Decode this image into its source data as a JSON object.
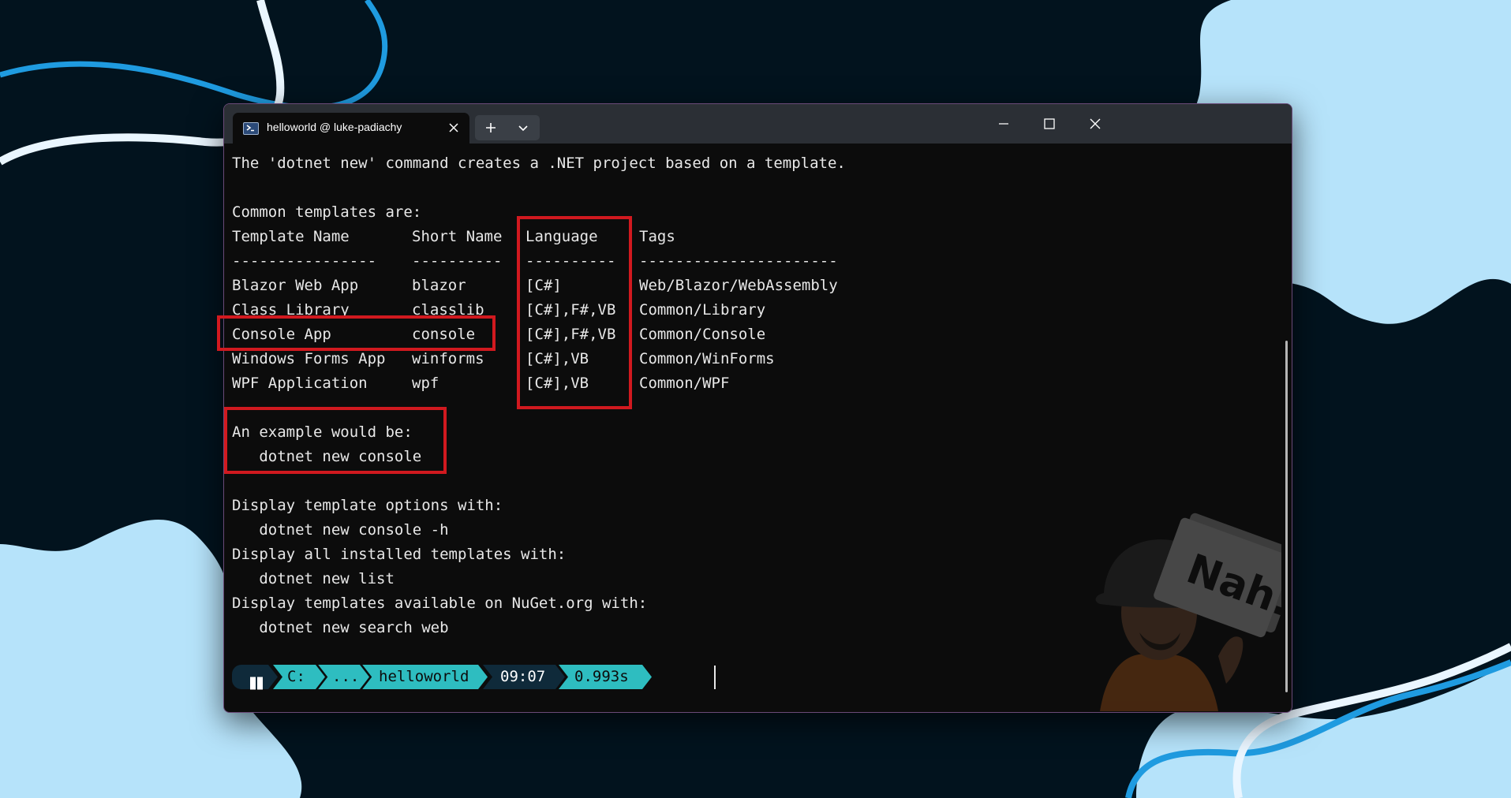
{
  "colors": {
    "background": "#02131e",
    "accent_blue": "#1f9be0",
    "light_blue_blob": "#b6e3fa",
    "terminal_bg": "#0c0c0c",
    "text": "#e8e8e8",
    "highlight_red": "#d1191f",
    "prompt_teal": "#2ebdc0",
    "prompt_dark": "#0f2a3a"
  },
  "window": {
    "tab_title": "helloworld @ luke-padiachy",
    "tab_icon": "powershell-icon",
    "new_tab_label": "+",
    "dropdown_icon": "chevron-down-icon",
    "controls": [
      "minimize-icon",
      "maximize-icon",
      "close-icon"
    ]
  },
  "terminal": {
    "intro": "The 'dotnet new' command creates a .NET project based on a template.",
    "common_label": "Common templates are:",
    "headers": [
      "Template Name",
      "Short Name",
      "Language",
      "Tags"
    ],
    "separators": [
      "----------------",
      "----------",
      "----------",
      "----------------------"
    ],
    "rows": [
      {
        "name": "Blazor Web App",
        "short": "blazor",
        "lang": "[C#]",
        "tags": "Web/Blazor/WebAssembly"
      },
      {
        "name": "Class Library",
        "short": "classlib",
        "lang": "[C#],F#,VB",
        "tags": "Common/Library"
      },
      {
        "name": "Console App",
        "short": "console",
        "lang": "[C#],F#,VB",
        "tags": "Common/Console"
      },
      {
        "name": "Windows Forms App",
        "short": "winforms",
        "lang": "[C#],VB",
        "tags": "Common/WinForms"
      },
      {
        "name": "WPF Application",
        "short": "wpf",
        "lang": "[C#],VB",
        "tags": "Common/WPF"
      }
    ],
    "example_label": "An example would be:",
    "example_cmd": "   dotnet new console",
    "options_label": "Display template options with:",
    "options_cmd": "   dotnet new console -h",
    "installed_label": "Display all installed templates with:",
    "installed_cmd": "   dotnet new list",
    "nuget_label": "Display templates available on NuGet.org with:",
    "nuget_cmd": "   dotnet new search web"
  },
  "prompt": {
    "os_icon": "windows-icon",
    "drive": "C:",
    "ellipsis": "...",
    "folder": "helloworld",
    "time": "09:07",
    "duration": "0.993s"
  },
  "sticker": {
    "sign_text": "Nah."
  }
}
